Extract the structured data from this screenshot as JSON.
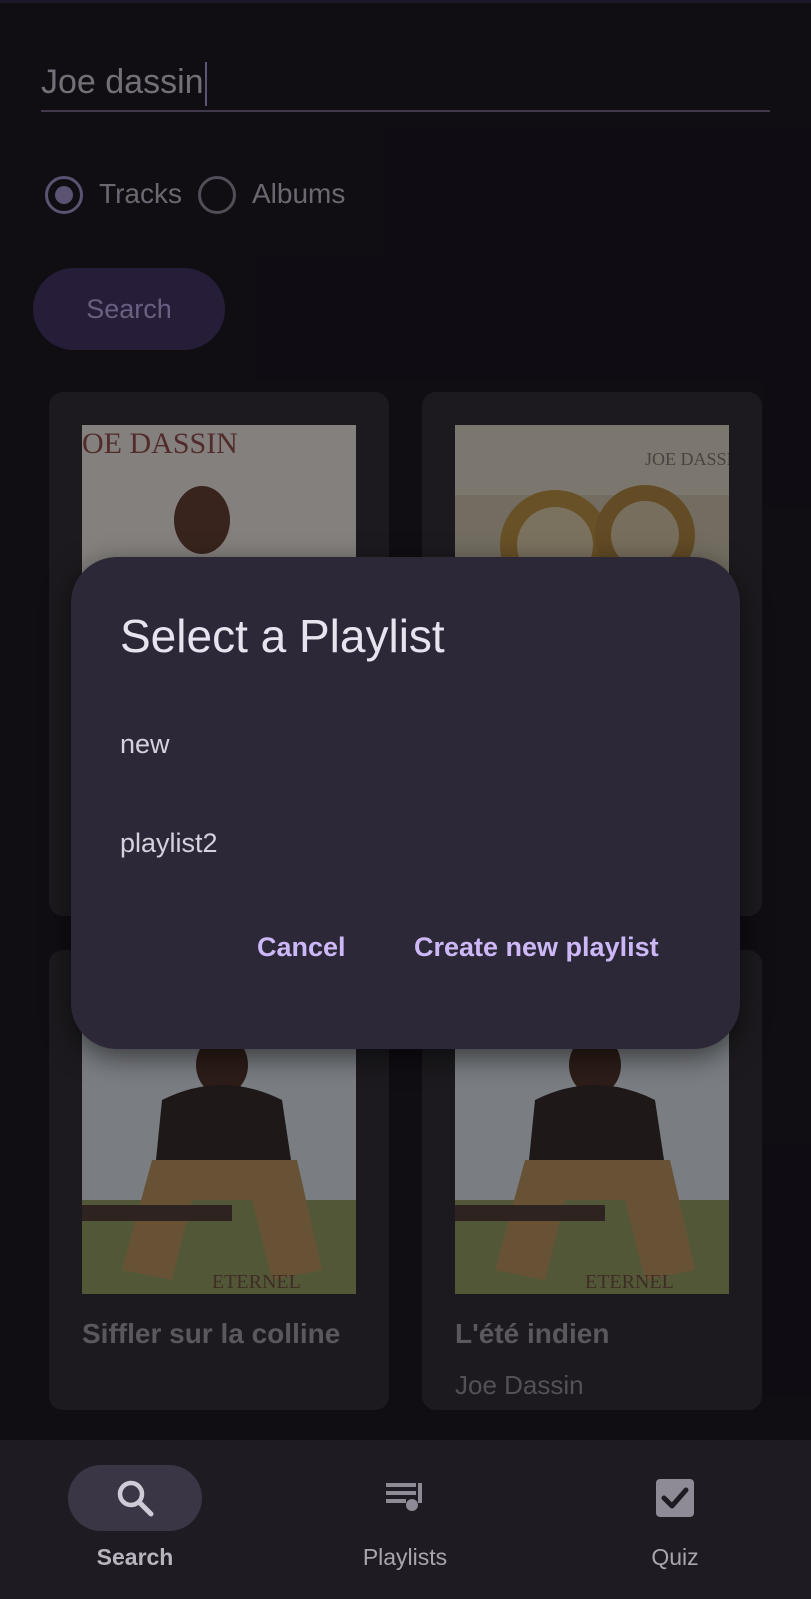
{
  "search": {
    "query": "Joe dassin"
  },
  "filter": {
    "options": [
      {
        "label": "Tracks",
        "selected": true
      },
      {
        "label": "Albums",
        "selected": false
      }
    ]
  },
  "search_button": {
    "label": "Search"
  },
  "results": {
    "cards": [
      {
        "title": "",
        "artist": "",
        "cover_text": "OE  DASSIN"
      },
      {
        "title": "",
        "artist": "",
        "cover_text": "JOE DASSIN"
      },
      {
        "title": "Siffler sur la colline",
        "artist": "",
        "cover_text": "ETERNEL"
      },
      {
        "title": "L'été indien",
        "artist": "Joe Dassin",
        "cover_text": "ETERNEL"
      }
    ]
  },
  "dialog": {
    "title": "Select a Playlist",
    "playlists": [
      "new",
      "playlist2"
    ],
    "cancel_label": "Cancel",
    "create_label": "Create new playlist"
  },
  "bottom_nav": {
    "items": [
      {
        "label": "Search",
        "icon": "search-icon",
        "active": true
      },
      {
        "label": "Playlists",
        "icon": "playlist-icon",
        "active": false
      },
      {
        "label": "Quiz",
        "icon": "checkbox-icon",
        "active": false
      }
    ]
  },
  "colors": {
    "background": "#141218",
    "accent": "#9f8fc4",
    "dialog": "#2c2837",
    "dialog_button": "#cdb8f7"
  }
}
